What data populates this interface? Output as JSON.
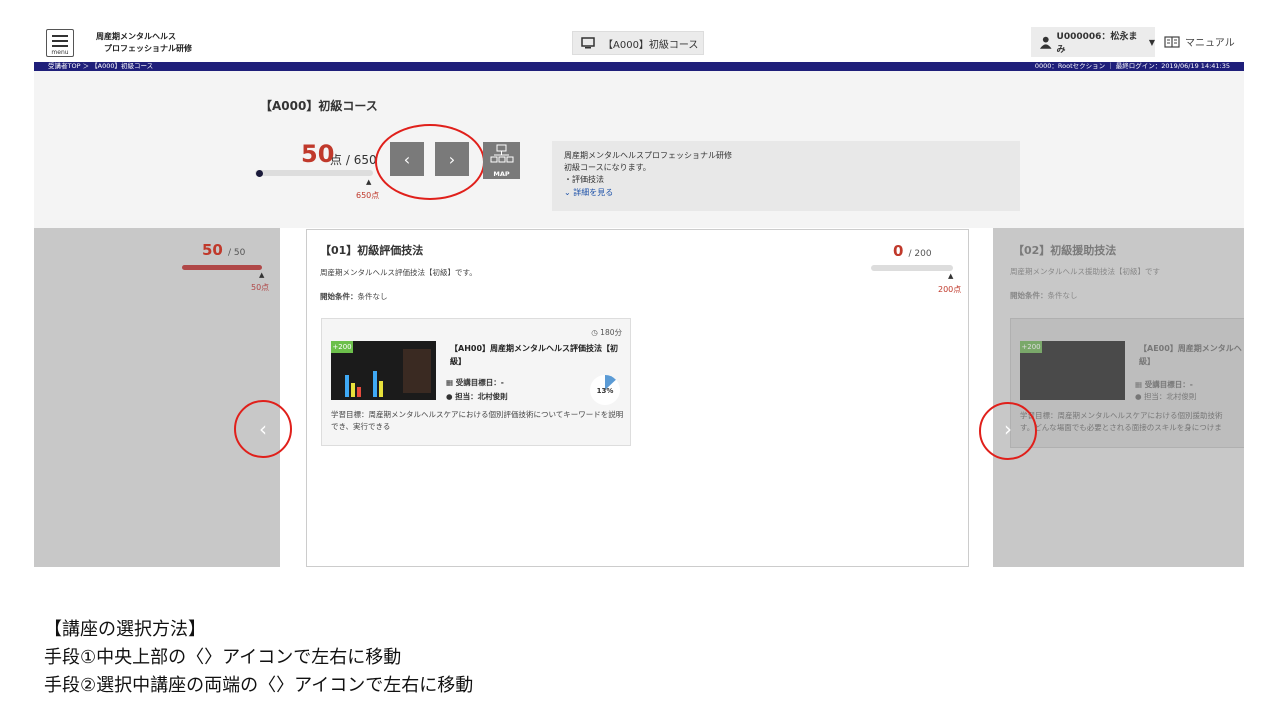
{
  "header": {
    "menu_label": "menu",
    "brand_line1": "周産期メンタルヘルス",
    "brand_line2": "プロフェッショナル研修",
    "course_chip": "【A000】初級コース",
    "user": "U000006：松永まみ",
    "manual": "マニュアル"
  },
  "navbar": {
    "breadcrumb": "受講者TOP ＞ 【A000】初級コース",
    "info": "0000：Rootセクション ｜ 最終ログイン：2019/06/19 14:41:35"
  },
  "course": {
    "title": "【A000】初級コース",
    "score": "50",
    "score_unit": "点",
    "score_total": "/ 650",
    "marker": "650点",
    "map_label": "MAP",
    "desc": [
      "周産期メンタルヘルスプロフェッショナル研修",
      "初級コースになります。",
      "・評価技法"
    ],
    "desc_more": "詳細を見る",
    "prev_label": "‹",
    "next_label": "›"
  },
  "left_card": {
    "score": "50",
    "score_total": "/ 50",
    "marker": "50点",
    "progress": 1.0
  },
  "center_card": {
    "title": "【01】初級評価技法",
    "desc": "周産期メンタルヘルス評価技法【初級】です。",
    "cond_label": "開始条件：",
    "cond_value": "条件なし",
    "score": "0",
    "score_total": "/ 200",
    "marker": "200点",
    "progress": 0.0,
    "unit": {
      "time": "180分",
      "badge": "+200",
      "title": "【AH00】周産期メンタルヘルス評価技法【初級】",
      "target_label": "受講目標日：-",
      "person_label": "担当：北村俊則",
      "percent": "13%",
      "percent_value": 13,
      "goal": "学習目標：周産期メンタルヘルスケアにおける個別評価技術についてキーワードを説明でき、実行できる"
    }
  },
  "right_card": {
    "title": "【02】初級援助技法",
    "desc": "周産期メンタルヘルス援助技法【初級】です",
    "cond_label": "開始条件：",
    "cond_value": "条件なし",
    "unit_title": "【AE00】周産期メンタルヘ",
    "unit_title2": "級】",
    "badge": "+200",
    "target_label": "受講目標日：-",
    "person_label": "担当：北村俊則",
    "goal": "学習目標：周産期メンタルヘルスケアにおける個別援助技術",
    "goal2": "す。どんな場面でも必要とされる面接のスキルを身につけま"
  },
  "notes": {
    "line1": "【講座の選択方法】",
    "line2": "手段①中央上部の〈〉アイコンで左右に移動",
    "line3": "手段②選択中講座の両端の〈〉アイコンで左右に移動"
  },
  "colors": {
    "accent_red": "#c0392b",
    "navbar": "#1f1f7a",
    "circle": "#e0201b"
  }
}
